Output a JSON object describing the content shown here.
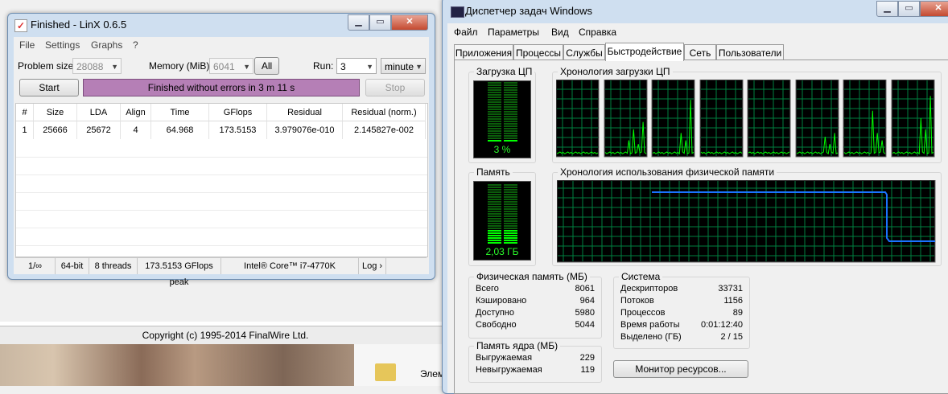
{
  "desktop": {
    "copyright": "Copyright (c) 1995-2014 FinalWire Ltd.",
    "folder_label": "Элем"
  },
  "linx": {
    "title": "Finished - LinX 0.6.5",
    "menu": [
      "File",
      "Settings",
      "Graphs",
      "?"
    ],
    "problem_size_label": "Problem size:",
    "problem_size_value": "28088",
    "memory_label": "Memory (MiB):",
    "memory_value": "6041",
    "all_button": "All",
    "run_label": "Run:",
    "run_value": "3",
    "run_unit": "minute",
    "start_button": "Start",
    "status_text": "Finished without errors in 3 m 11 s",
    "stop_button": "Stop",
    "table": {
      "columns": [
        "#",
        "Size",
        "LDA",
        "Align",
        "Time",
        "GFlops",
        "Residual",
        "Residual (norm.)"
      ],
      "rows": [
        [
          "1",
          "25666",
          "25672",
          "4",
          "64.968",
          "173.5153",
          "3.979076e-010",
          "2.145827e-002"
        ]
      ]
    },
    "statusbar": [
      "1/∞",
      "64-bit",
      "8 threads",
      "173.5153 GFlops peak",
      "Intel® Core™ i7-4770K",
      "Log ›"
    ]
  },
  "taskmgr": {
    "title": "Диспетчер задач Windows",
    "menu": [
      "Файл",
      "Параметры",
      "Вид",
      "Справка"
    ],
    "tabs": [
      "Приложения",
      "Процессы",
      "Службы",
      "Быстродействие",
      "Сеть",
      "Пользователи"
    ],
    "active_tab": 3,
    "cpu_usage_title": "Загрузка ЦП",
    "cpu_usage_value": "3 %",
    "cpu_usage_fraction": 0.03,
    "cpu_history_title": "Хронология загрузки ЦП",
    "memory_title": "Память",
    "memory_value": "2,03 ГБ",
    "memory_fraction": 0.25,
    "memory_history_title": "Хронология использования физической памяти",
    "physical_memory": {
      "title": "Физическая память (МБ)",
      "rows": [
        {
          "k": "Всего",
          "v": "8061"
        },
        {
          "k": "Кэшировано",
          "v": "964"
        },
        {
          "k": "Доступно",
          "v": "5980"
        },
        {
          "k": "Свободно",
          "v": "5044"
        }
      ]
    },
    "kernel_memory": {
      "title": "Память ядра (МБ)",
      "rows": [
        {
          "k": "Выгружаемая",
          "v": "229"
        },
        {
          "k": "Невыгружаемая",
          "v": "119"
        }
      ]
    },
    "system": {
      "title": "Система",
      "rows": [
        {
          "k": "Дескрипторов",
          "v": "33731"
        },
        {
          "k": "Потоков",
          "v": "1156"
        },
        {
          "k": "Процессов",
          "v": "89"
        },
        {
          "k": "Время работы",
          "v": "0:01:12:40"
        },
        {
          "k": "Выделено (ГБ)",
          "v": "2 / 15"
        }
      ]
    },
    "resource_monitor_button": "Монитор ресурсов...",
    "colors": {
      "graph_line": "#00ff00",
      "grid": "#008040",
      "memory_line": "#1a73ff"
    }
  }
}
